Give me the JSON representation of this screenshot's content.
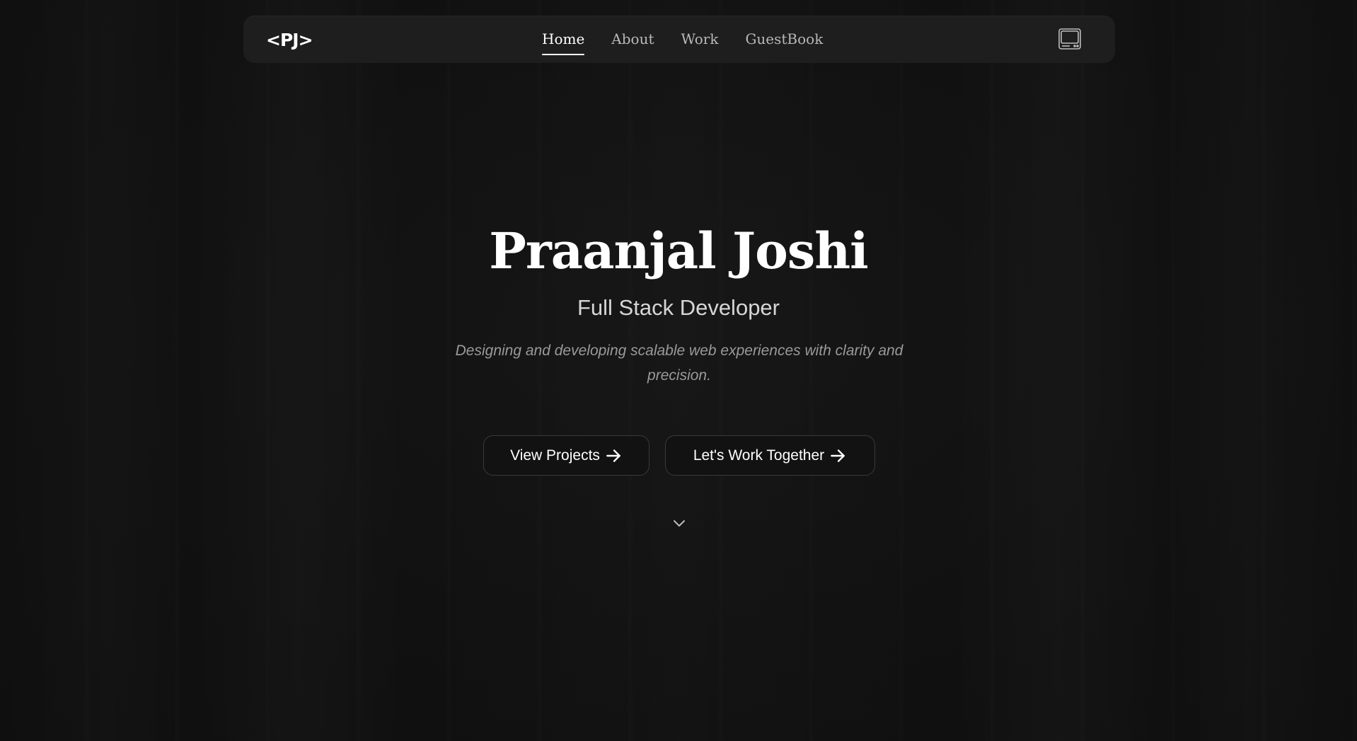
{
  "nav": {
    "logo": "<PJ>",
    "links": [
      {
        "label": "Home",
        "active": true
      },
      {
        "label": "About",
        "active": false
      },
      {
        "label": "Work",
        "active": false
      },
      {
        "label": "GuestBook",
        "active": false
      }
    ],
    "theme_toggle_icon": "retro-tv-icon"
  },
  "hero": {
    "name": "Praanjal Joshi",
    "role": "Full Stack Developer",
    "tagline": "Designing and developing scalable web experiences with clarity and precision.",
    "buttons": {
      "projects_label": "View Projects",
      "contact_label": "Let's Work Together",
      "arrow_icon": "arrow-right-icon"
    },
    "scroll_icon": "chevron-down-icon"
  },
  "colors": {
    "background": "#111111",
    "navbar": "#1e1e1e",
    "text_primary": "#ffffff",
    "text_secondary": "#d6d6d6",
    "text_muted": "#9a9a9a",
    "nav_inactive": "#b8b8b8",
    "button_border": "#3a3a3a"
  }
}
